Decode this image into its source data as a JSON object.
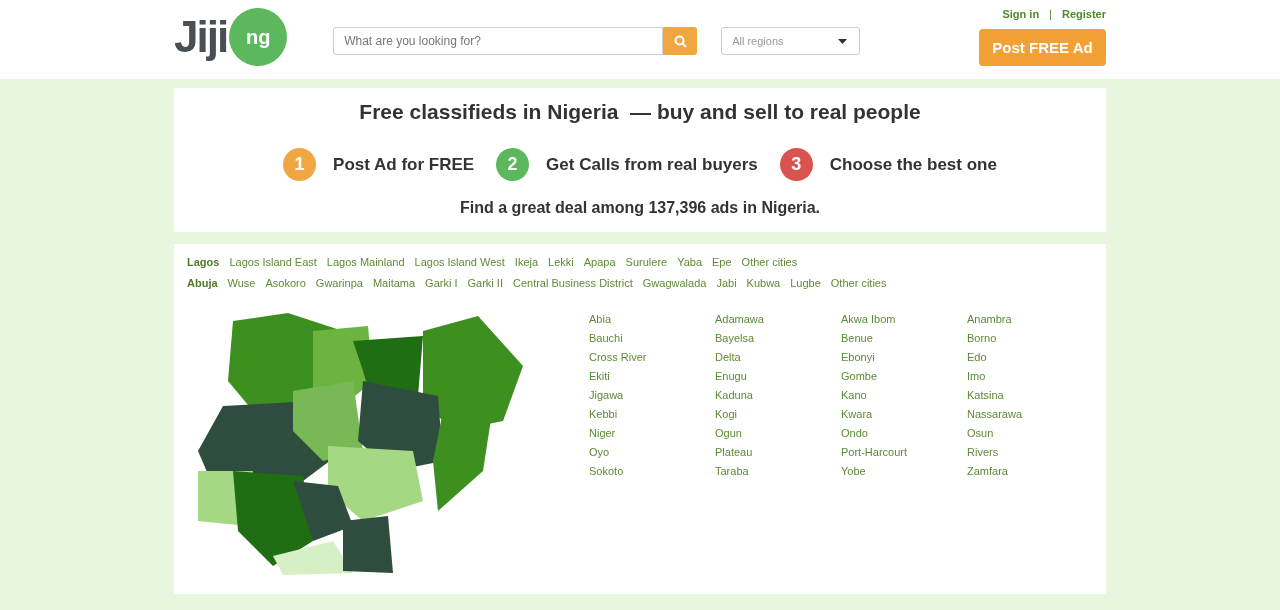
{
  "header": {
    "logo": {
      "word": "Jiji",
      "badge": "ng"
    },
    "search": {
      "placeholder": "What are you looking for?"
    },
    "region_select": {
      "value": "All regions"
    },
    "auth_links": [
      "Sign in",
      "Register"
    ],
    "auth_separator": "|",
    "post_button": "Post FREE Ad"
  },
  "hero": {
    "title": "Free classifieds in Nigeria  — buy and sell to real people",
    "steps": [
      {
        "number": "1",
        "label": "Post Ad for FREE",
        "color": "#f0a742"
      },
      {
        "number": "2",
        "label": "Get Calls from real buyers",
        "color": "#5cb85c"
      },
      {
        "number": "3",
        "label": "Choose the best one",
        "color": "#d9534f"
      }
    ],
    "summary": "Find a great deal among 137,396 ads in Nigeria."
  },
  "city_rows": [
    {
      "city": "Lagos",
      "areas": [
        "Lagos Island East",
        "Lagos Mainland",
        "Lagos Island West",
        "Ikeja",
        "Lekki",
        "Apapa",
        "Surulere",
        "Yaba",
        "Epe",
        "Other cities"
      ]
    },
    {
      "city": "Abuja",
      "areas": [
        "Wuse",
        "Asokoro",
        "Gwarinpa",
        "Maitama",
        "Garki I",
        "Garki II",
        "Central Business District",
        "Gwagwalada",
        "Jabi",
        "Kubwa",
        "Lugbe",
        "Other cities"
      ]
    }
  ],
  "states": [
    "Abia",
    "Adamawa",
    "Akwa Ibom",
    "Anambra",
    "Bauchi",
    "Bayelsa",
    "Benue",
    "Borno",
    "Cross River",
    "Delta",
    "Ebonyi",
    "Edo",
    "Ekiti",
    "Enugu",
    "Gombe",
    "Imo",
    "Jigawa",
    "Kaduna",
    "Kano",
    "Katsina",
    "Kebbi",
    "Kogi",
    "Kwara",
    "Nassarawa",
    "Niger",
    "Ogun",
    "Ondo",
    "Osun",
    "Oyo",
    "Plateau",
    "Port-Harcourt",
    "Rivers",
    "Sokoto",
    "Taraba",
    "Yobe",
    "Zamfara"
  ]
}
